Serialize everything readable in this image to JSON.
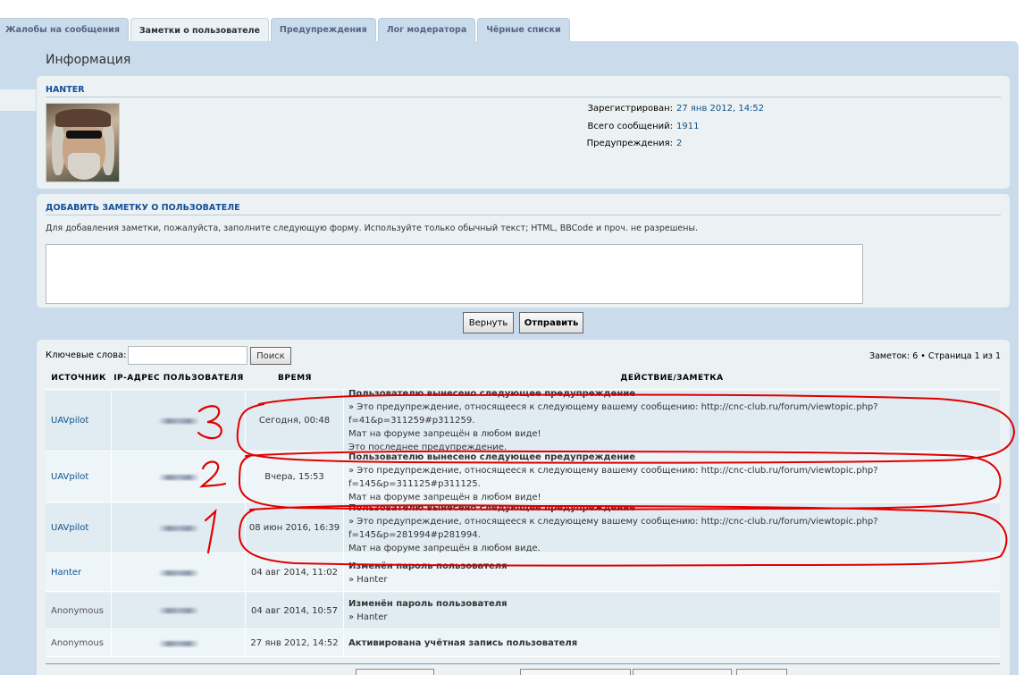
{
  "tabs": [
    {
      "label": "Жалобы на сообщения",
      "active": false
    },
    {
      "label": "Заметки о пользователе",
      "active": true
    },
    {
      "label": "Предупреждения",
      "active": false
    },
    {
      "label": "Лог модератора",
      "active": false
    },
    {
      "label": "Чёрные списки",
      "active": false
    }
  ],
  "page_title": "Информация",
  "user": {
    "name": "HANTER",
    "registered_label": "Зарегистрирован:",
    "registered_value": "27 янв 2012, 14:52",
    "posts_label": "Всего сообщений:",
    "posts_value": "1911",
    "warnings_label": "Предупреждения:",
    "warnings_value": "2"
  },
  "add_note": {
    "title": "ДОБАВИТЬ ЗАМЕТКУ О ПОЛЬЗОВАТЕЛЕ",
    "description": "Для добавления заметки, пожалуйста, заполните следующую форму. Используйте только обычный текст; HTML, BBCode и проч. не разрешены.",
    "textarea_value": ""
  },
  "buttons": {
    "reset": "Вернуть",
    "submit": "Отправить"
  },
  "search": {
    "label": "Ключевые слова:",
    "value": "",
    "button": "Поиск"
  },
  "counts": "Заметок: 6 • Страница 1 из 1",
  "table": {
    "headers": [
      "ИСТОЧНИК",
      "IP-АДРЕС ПОЛЬЗОВАТЕЛЯ",
      "ВРЕМЯ",
      "ДЕЙСТВИЕ/ЗАМЕТКА"
    ],
    "rows": [
      {
        "source": "UAVpilot",
        "time": "Сегодня, 00:48",
        "title": "Пользователю вынесено следующее предупреждение",
        "lines": [
          "» Это предупреждение, относящееся к следующему вашему сообщению: http://cnc-club.ru/forum/viewtopic.php?f=41&p=311259#p311259.",
          "Мат на форуме запрещён в любом виде!",
          "Это последнее предупреждение."
        ]
      },
      {
        "source": "UAVpilot",
        "time": "Вчера, 15:53",
        "title": "Пользователю вынесено следующее предупреждение",
        "lines": [
          "» Это предупреждение, относящееся к следующему вашему сообщению: http://cnc-club.ru/forum/viewtopic.php?f=145&p=311125#p311125.",
          "Мат на форуме запрещён в любом виде!"
        ]
      },
      {
        "source": "UAVpilot",
        "time": "08 июн 2016, 16:39",
        "title": "Пользователю вынесено следующее предупреждение",
        "lines": [
          "» Это предупреждение, относящееся к следующему вашему сообщению: http://cnc-club.ru/forum/viewtopic.php?f=145&p=281994#p281994.",
          "Мат на форуме запрещён в любом виде."
        ]
      },
      {
        "source": "Hanter",
        "time": "04 авг 2014, 11:02",
        "title": "Изменён пароль пользователя",
        "lines": [
          "» Hanter"
        ]
      },
      {
        "source": "Anonymous",
        "time": "04 авг 2014, 10:57",
        "title": "Изменён пароль пользователя",
        "lines": [
          "» Hanter"
        ]
      },
      {
        "source": "Anonymous",
        "time": "27 янв 2012, 14:52",
        "title": "Активирована учётная запись пользователя",
        "lines": []
      }
    ]
  },
  "annotations": {
    "marks": [
      "3",
      "2",
      "1"
    ],
    "color": "#e00000"
  }
}
